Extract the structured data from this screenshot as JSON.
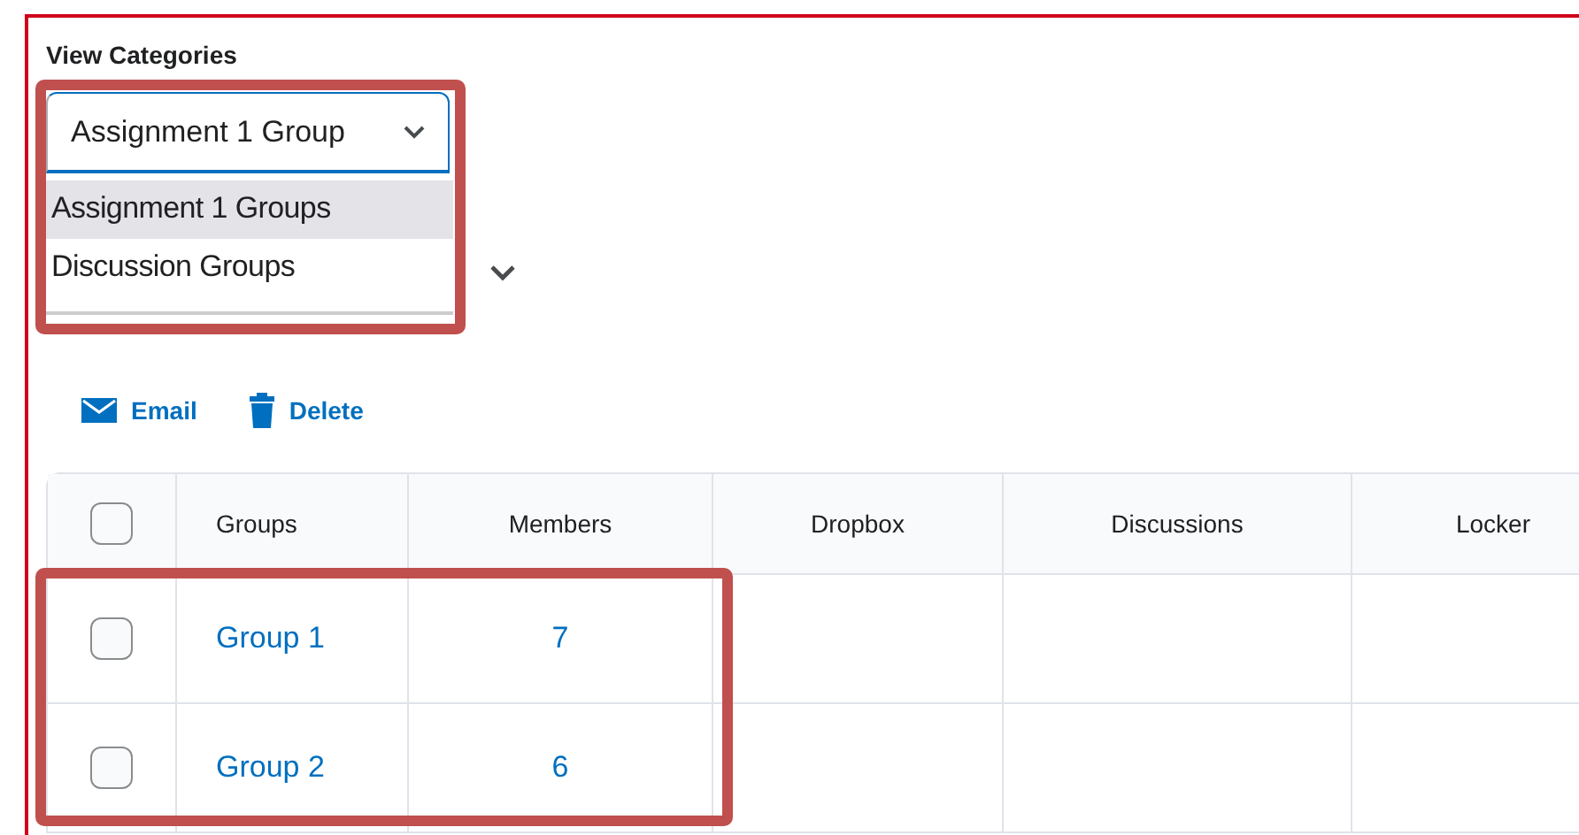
{
  "title": "View Categories",
  "category_select": {
    "value": "Assignment 1 Group",
    "expanded": true,
    "options": [
      {
        "label": "Assignment 1 Groups",
        "selected": true
      },
      {
        "label": "Discussion Groups",
        "selected": false
      }
    ]
  },
  "toolbar": [
    {
      "kind": "email",
      "label": "Email"
    },
    {
      "kind": "delete",
      "label": "Delete"
    }
  ],
  "table": {
    "header_checked": false,
    "columns": [
      "Groups",
      "Members",
      "Dropbox",
      "Discussions",
      "Locker"
    ],
    "rows": [
      {
        "checked": false,
        "cells": [
          "Group 1",
          "7",
          "",
          "",
          ""
        ]
      },
      {
        "checked": false,
        "cells": [
          "Group 2",
          "6",
          "",
          "",
          ""
        ]
      }
    ]
  }
}
